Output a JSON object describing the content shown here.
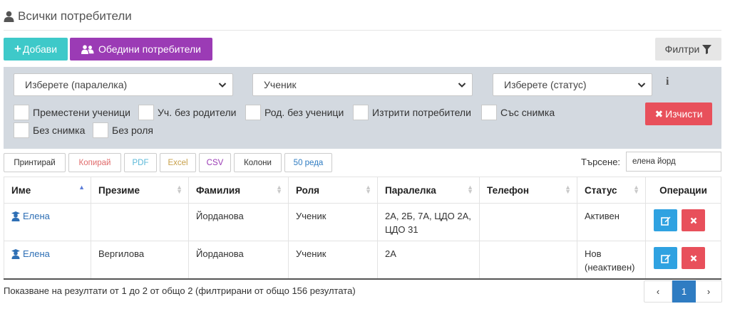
{
  "header": {
    "title": "Всички потребители",
    "icon": "user-icon"
  },
  "toolbar": {
    "add_label": "Добави",
    "merge_label": "Обедини потребители",
    "filter_label": "Филтри",
    "colors": {
      "add": "#3ec9c9",
      "merge": "#9b3bb5",
      "clear": "#e8505b",
      "edit": "#2fa2e1",
      "delete": "#e8505b",
      "page": "#2f7cc2"
    }
  },
  "filters": {
    "class_select": "Изберете (паралелка)",
    "role_select": "Ученик",
    "status_select": "Изберете (статус)",
    "info_icon": "i",
    "checkboxes": [
      {
        "label": "Преместени ученици",
        "checked": false
      },
      {
        "label": "Уч. без родители",
        "checked": false
      },
      {
        "label": "Род. без ученици",
        "checked": false
      },
      {
        "label": "Изтрити потребители",
        "checked": false
      },
      {
        "label": "Със снимка",
        "checked": false
      },
      {
        "label": "Без снимка",
        "checked": false
      },
      {
        "label": "Без роля",
        "checked": false
      }
    ],
    "clear_label": "Изчисти"
  },
  "export": {
    "buttons": [
      {
        "label": "Принтирай",
        "color": "#333333"
      },
      {
        "label": "Копирай",
        "color": "#e06b6b"
      },
      {
        "label": "PDF",
        "color": "#5ab8d8"
      },
      {
        "label": "Excel",
        "color": "#c8a04a"
      },
      {
        "label": "CSV",
        "color": "#9b3bb5"
      },
      {
        "label": "Колони",
        "color": "#333333"
      },
      {
        "label": "50 реда",
        "color": "#2f7cc2"
      }
    ]
  },
  "search": {
    "label": "Търсене:",
    "value": "елена йорд"
  },
  "table": {
    "columns": [
      "Име",
      "Презиме",
      "Фамилия",
      "Роля",
      "Паралелка",
      "Телефон",
      "Статус",
      "Операции"
    ],
    "rows": [
      {
        "name": "Елена",
        "middle": "",
        "last": "Йорданова",
        "role": "Ученик",
        "class": "2А, 2Б, 7А, ЦДО 2А, ЦДО 31",
        "phone": "",
        "status": "Активен"
      },
      {
        "name": "Елена",
        "middle": "Вергилова",
        "last": "Йорданова",
        "role": "Ученик",
        "class": "2А",
        "phone": "",
        "status": "Нов (неактивен)"
      }
    ]
  },
  "footer": {
    "summary": "Показване на резултати от 1 до 2 от общо 2 (филтрирани от общо 156 резултата)",
    "pagination": {
      "prev": "‹",
      "current": "1",
      "next": "›"
    }
  }
}
